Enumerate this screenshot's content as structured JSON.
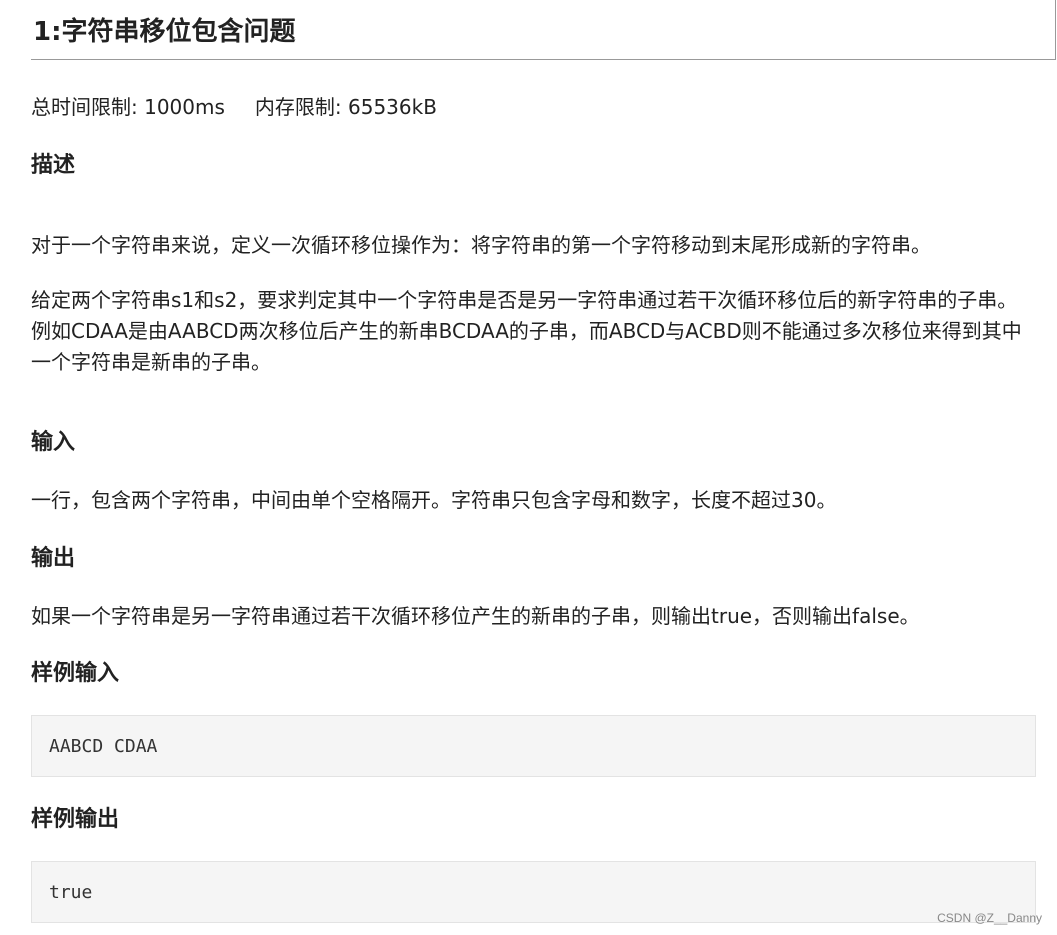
{
  "problem": {
    "title": "1:字符串移位包含问题",
    "time_limit": "总时间限制: 1000ms",
    "memory_limit": "内存限制: 65536kB"
  },
  "sections": {
    "description": {
      "heading": "描述",
      "para1": "对于一个字符串来说，定义一次循环移位操作为：将字符串的第一个字符移动到末尾形成新的字符串。",
      "para2": "给定两个字符串s1和s2，要求判定其中一个字符串是否是另一字符串通过若干次循环移位后的新字符串的子串。例如CDAA是由AABCD两次移位后产生的新串BCDAA的子串，而ABCD与ACBD则不能通过多次移位来得到其中一个字符串是新串的子串。"
    },
    "input": {
      "heading": "输入",
      "text": "一行，包含两个字符串，中间由单个空格隔开。字符串只包含字母和数字，长度不超过30。"
    },
    "output": {
      "heading": "输出",
      "text": "如果一个字符串是另一字符串通过若干次循环移位产生的新串的子串，则输出true，否则输出false。"
    },
    "sample_input": {
      "heading": "样例输入",
      "code": "AABCD CDAA"
    },
    "sample_output": {
      "heading": "样例输出",
      "code": "true"
    }
  },
  "watermark": "CSDN @Z__Danny"
}
